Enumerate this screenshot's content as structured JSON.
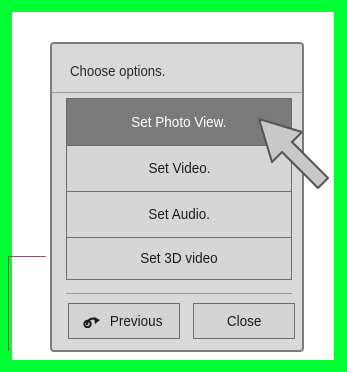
{
  "dialog": {
    "title": "Choose options.",
    "options": [
      {
        "label": "Set Photo View.",
        "selected": true
      },
      {
        "label": "Set Video.",
        "selected": false
      },
      {
        "label": "Set Audio.",
        "selected": false
      },
      {
        "label": "Set 3D video",
        "selected": false
      }
    ],
    "buttons": {
      "previous_label": "Previous",
      "close_label": "Close"
    }
  },
  "icons": {
    "back": "back-arrow-icon",
    "pointer": "pointer-arrow-icon"
  },
  "colors": {
    "frame": "#00ff33",
    "dialog_bg": "#d9d9d9",
    "selected_bg": "#7a7a7a",
    "selected_text": "#ffffff",
    "annotation_line": "#a8485a"
  }
}
